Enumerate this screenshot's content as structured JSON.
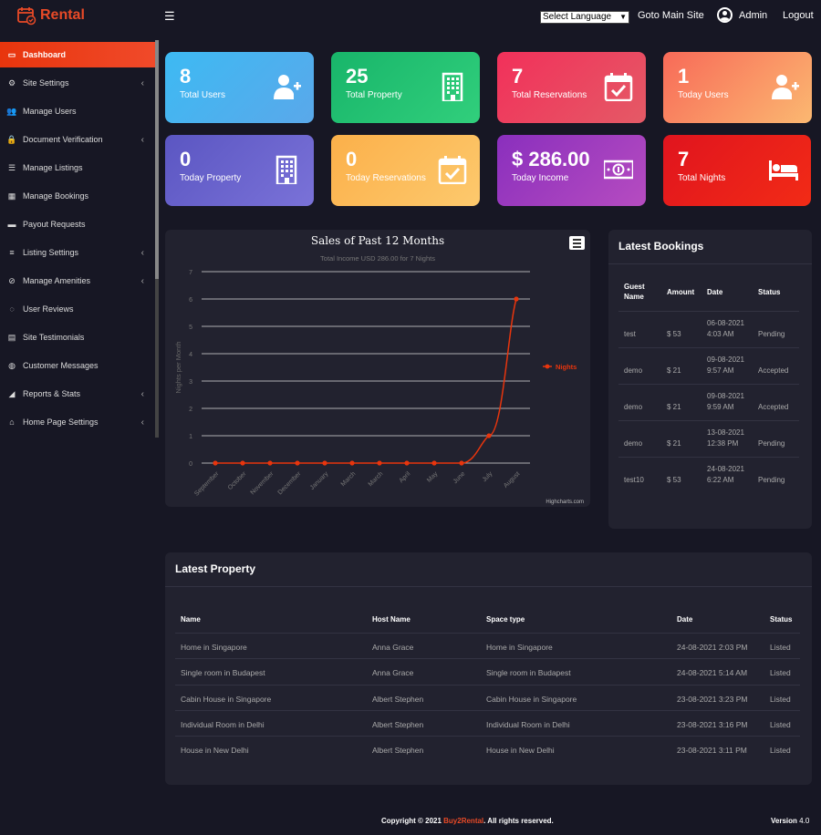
{
  "app": {
    "logo_text": "Rental"
  },
  "topbar": {
    "language_select": "Select Language",
    "goto_main_site": "Goto Main Site",
    "admin_name": "Admin",
    "logout": "Logout"
  },
  "sidebar": {
    "items": [
      {
        "label": "Dashboard",
        "icon": "monitor-icon",
        "active": true,
        "chevron": false
      },
      {
        "label": "Site Settings",
        "icon": "gear-icon",
        "active": false,
        "chevron": true
      },
      {
        "label": "Manage Users",
        "icon": "users-icon",
        "active": false,
        "chevron": false
      },
      {
        "label": "Document Verification",
        "icon": "lock-icon",
        "active": false,
        "chevron": true
      },
      {
        "label": "Manage Listings",
        "icon": "list-icon",
        "active": false,
        "chevron": false
      },
      {
        "label": "Manage Bookings",
        "icon": "calendar-icon",
        "active": false,
        "chevron": false
      },
      {
        "label": "Payout Requests",
        "icon": "credit-card-icon",
        "active": false,
        "chevron": false
      },
      {
        "label": "Listing Settings",
        "icon": "sliders-icon",
        "active": false,
        "chevron": true
      },
      {
        "label": "Manage Amenities",
        "icon": "check-circle-icon",
        "active": false,
        "chevron": true
      },
      {
        "label": "User Reviews",
        "icon": "comment-icon",
        "active": false,
        "chevron": false
      },
      {
        "label": "Site Testimonials",
        "icon": "table-icon",
        "active": false,
        "chevron": false
      },
      {
        "label": "Customer Messages",
        "icon": "chat-icon",
        "active": false,
        "chevron": false
      },
      {
        "label": "Reports & Stats",
        "icon": "area-chart-icon",
        "active": false,
        "chevron": true
      },
      {
        "label": "Home Page Settings",
        "icon": "home-icon",
        "active": false,
        "chevron": true
      }
    ]
  },
  "stats": [
    {
      "value": "8",
      "label": "Total Users",
      "icon": "user-plus-icon"
    },
    {
      "value": "25",
      "label": "Total Property",
      "icon": "building-icon"
    },
    {
      "value": "7",
      "label": "Total Reservations",
      "icon": "calendar-check-icon"
    },
    {
      "value": "1",
      "label": "Today Users",
      "icon": "user-plus-icon"
    },
    {
      "value": "0",
      "label": "Today Property",
      "icon": "building-icon"
    },
    {
      "value": "0",
      "label": "Today Reservations",
      "icon": "calendar-check-icon"
    },
    {
      "value": "$ 286.00",
      "label": "Today Income",
      "icon": "money-icon"
    },
    {
      "value": "7",
      "label": "Total Nights",
      "icon": "bed-icon"
    }
  ],
  "chart_data": {
    "type": "line",
    "title": "Sales of Past 12 Months",
    "subtitle": "Total Income USD 286.00 for 7 Nights",
    "ylabel": "Nights per Month",
    "xlabel": "",
    "ylim": [
      0,
      7
    ],
    "yticks": [
      0,
      1,
      2,
      3,
      4,
      5,
      6,
      7
    ],
    "categories": [
      "September",
      "October",
      "November",
      "December",
      "January",
      "March",
      "March",
      "April",
      "May",
      "June",
      "July",
      "August"
    ],
    "series": [
      {
        "name": "Nights",
        "values": [
          0,
          0,
          0,
          0,
          0,
          0,
          0,
          0,
          0,
          0,
          1,
          6
        ]
      }
    ],
    "legend": "right",
    "grid": true,
    "credit": "Highcharts.com",
    "line_color": "#e8350d"
  },
  "bookings": {
    "title": "Latest Bookings",
    "headers": {
      "guest": "Guest Name",
      "amount": "Amount",
      "date": "Date",
      "status": "Status"
    },
    "rows": [
      {
        "guest": "test",
        "amount": "$ 53",
        "date": "06-08-2021 4:03 AM",
        "status": "Pending"
      },
      {
        "guest": "demo",
        "amount": "$ 21",
        "date": "09-08-2021 9:57 AM",
        "status": "Accepted"
      },
      {
        "guest": "demo",
        "amount": "$ 21",
        "date": "09-08-2021 9:59 AM",
        "status": "Accepted"
      },
      {
        "guest": "demo",
        "amount": "$ 21",
        "date": "13-08-2021 12:38 PM",
        "status": "Pending"
      },
      {
        "guest": "test10",
        "amount": "$ 53",
        "date": "24-08-2021 6:22 AM",
        "status": "Pending"
      }
    ]
  },
  "property": {
    "title": "Latest Property",
    "headers": {
      "name": "Name",
      "host": "Host Name",
      "space": "Space type",
      "date": "Date",
      "status": "Status"
    },
    "rows": [
      {
        "name": "Home in Singapore",
        "host": "Anna Grace",
        "space": "Home in Singapore",
        "date": "24-08-2021 2:03 PM",
        "status": "Listed"
      },
      {
        "name": "Single room in Budapest",
        "host": "Anna Grace",
        "space": "Single room in Budapest",
        "date": "24-08-2021 5:14 AM",
        "status": "Listed"
      },
      {
        "name": "Cabin House in Singapore",
        "host": "Albert Stephen",
        "space": "Cabin House in Singapore",
        "date": "23-08-2021 3:23 PM",
        "status": "Listed"
      },
      {
        "name": "Individual Room in Delhi",
        "host": "Albert Stephen",
        "space": "Individual Room in Delhi",
        "date": "23-08-2021 3:16 PM",
        "status": "Listed"
      },
      {
        "name": "House in New Delhi",
        "host": "Albert Stephen",
        "space": "House in New Delhi",
        "date": "23-08-2021 3:11 PM",
        "status": "Listed"
      }
    ]
  },
  "footer": {
    "copyright_prefix": "Copyright © 2021 ",
    "brand": "Buy2Rental",
    "copyright_suffix": ". All rights reserved.",
    "version_label": "Version",
    "version_value": "4.0"
  },
  "colors": {
    "accent": "#e84a27",
    "background": "#171724",
    "panel": "#22222f"
  }
}
